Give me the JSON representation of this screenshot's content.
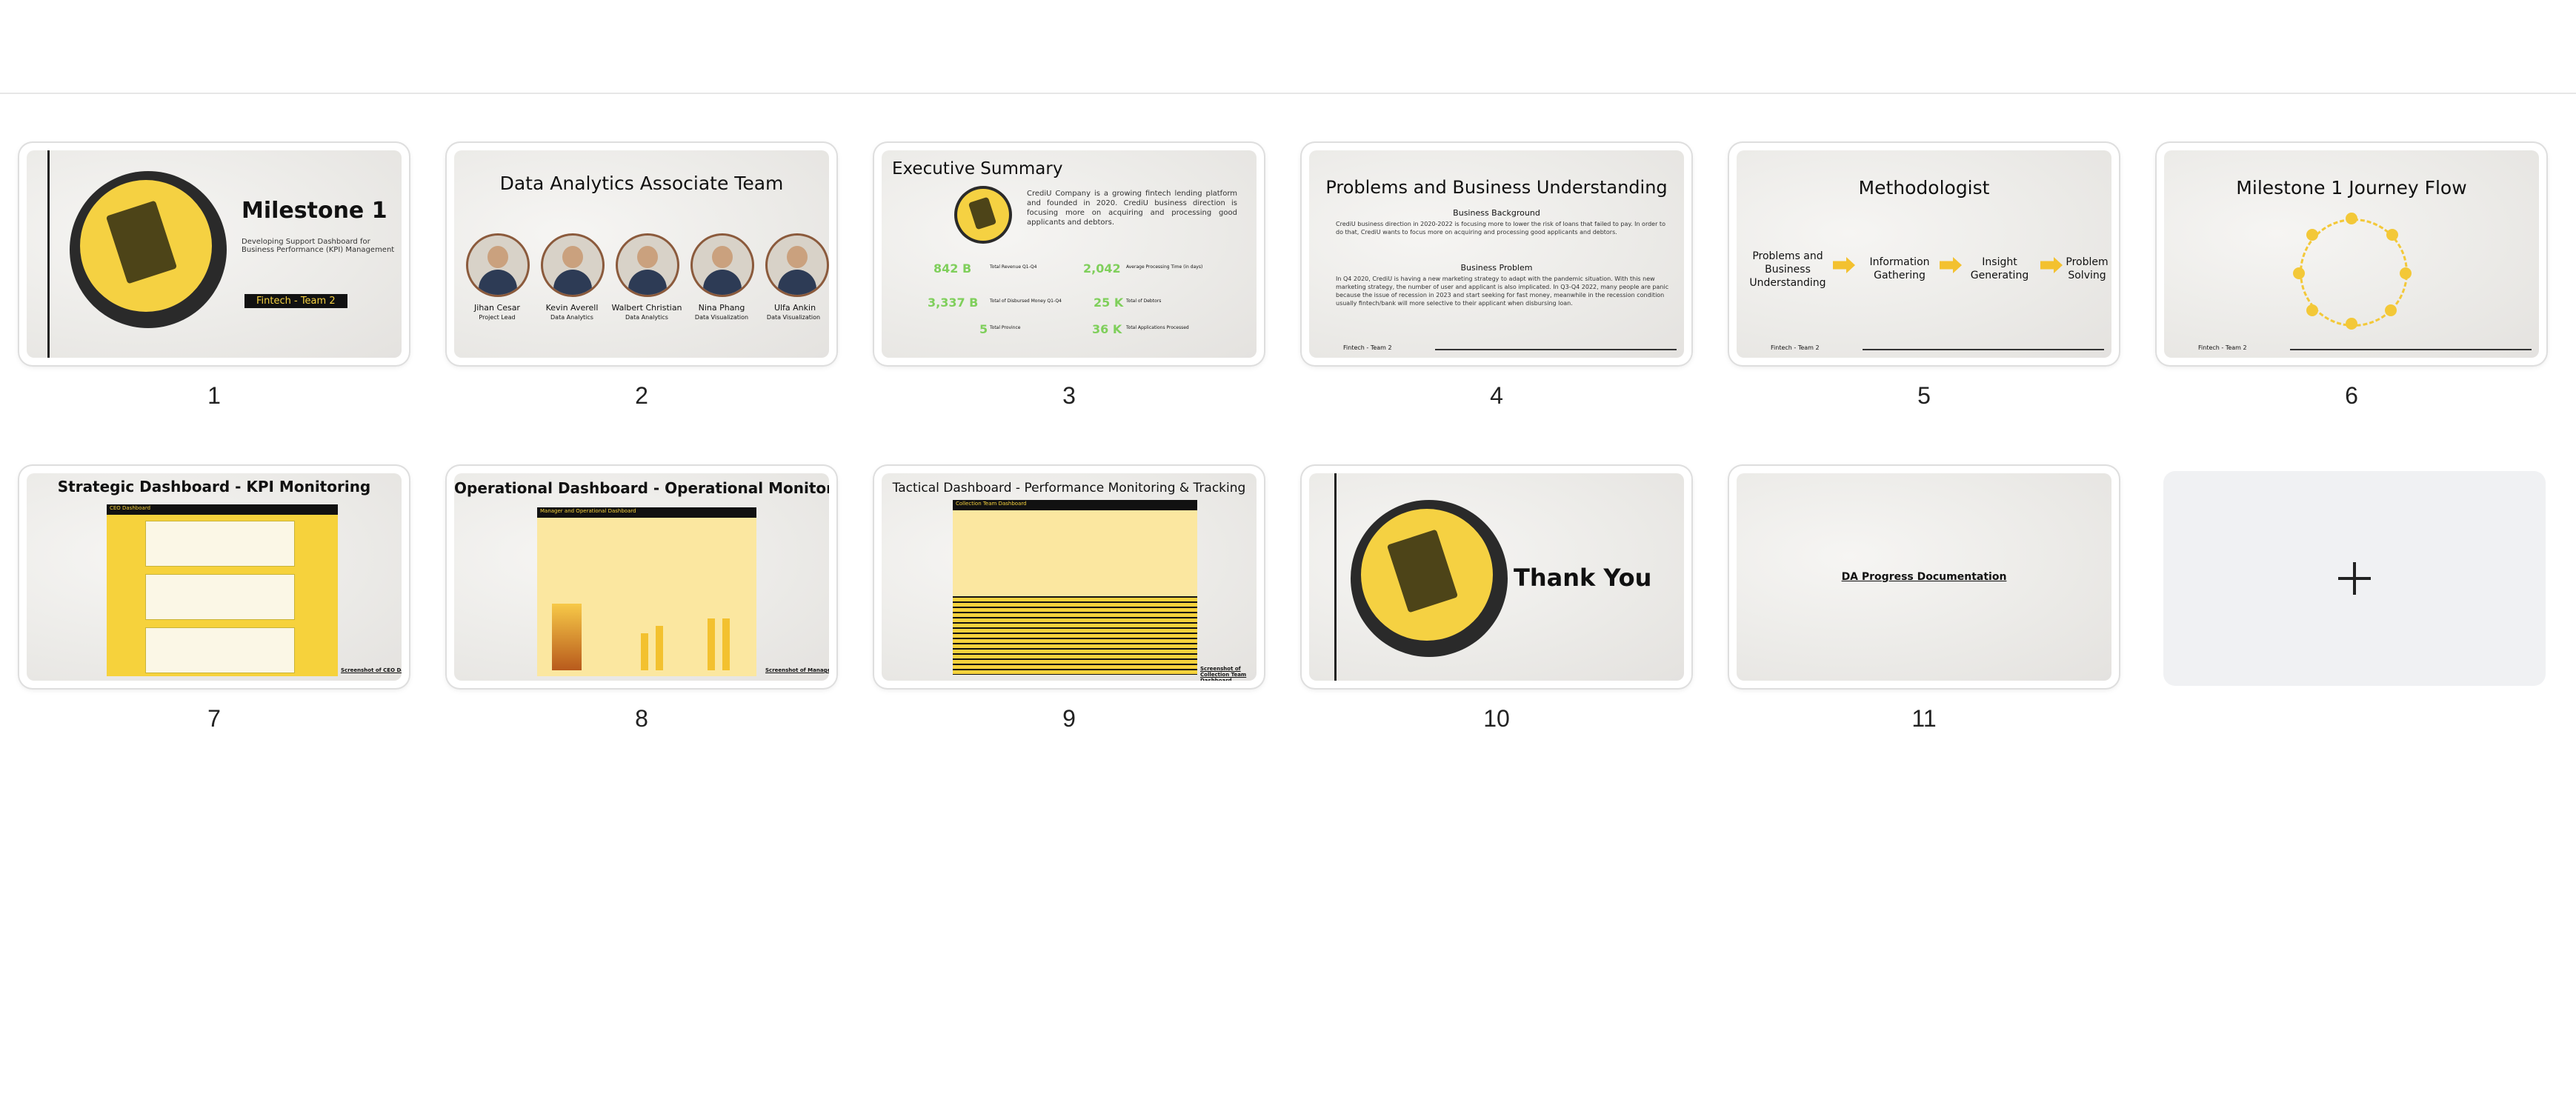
{
  "slides": [
    {
      "number": "1",
      "title": "Milestone 1",
      "subtitle": "Developing Support Dashboard for Business Performance (KPI) Management",
      "badge": "Fintech - Team 2"
    },
    {
      "number": "2",
      "title": "Data Analytics Associate Team",
      "members": [
        {
          "name": "Jihan Cesar",
          "role": "Project Lead"
        },
        {
          "name": "Kevin Averell",
          "role": "Data Analytics"
        },
        {
          "name": "Walbert Christian",
          "role": "Data Analytics"
        },
        {
          "name": "Nina Phang",
          "role": "Data Visualization"
        },
        {
          "name": "Ulfa Ankin",
          "role": "Data Visualization"
        }
      ]
    },
    {
      "number": "3",
      "title": "Executive Summary",
      "body": "CrediU Company is a growing fintech lending platform and founded in 2020. CrediU business direction is focusing more on acquiring and processing good applicants and debtors.",
      "kpis": [
        {
          "value": "842 B",
          "label": "Total Revenue Q1-Q4"
        },
        {
          "value": "2,042",
          "label": "Average Processing Time (in days)"
        },
        {
          "value": "3,337 B",
          "label": "Total of Disbursed Money Q1-Q4"
        },
        {
          "value": "25 K",
          "label": "Total of Debtors"
        },
        {
          "value": "5",
          "label": "Total Province"
        },
        {
          "value": "36 K",
          "label": "Total Applications Processed"
        }
      ]
    },
    {
      "number": "4",
      "title": "Problems and Business Understanding",
      "h1": "Business Background",
      "p1": "CrediU business direction in 2020-2022 is focusing more to lower the risk of loans that failed to pay. In order to do that, CrediU wants to focus more on acquiring and processing good applicants and debtors.",
      "h2": "Business Problem",
      "p2": "In Q4 2020, CrediU is having a new marketing strategy to adapt with the pandemic situation. With this new marketing strategy, the number of user and applicant is also implicated. In Q3-Q4 2022, many people are panic because the issue of recession in 2023 and start seeking for fast money, meanwhile in the recession condition usually fintech/bank will more selective to their applicant when disbursing loan.",
      "footer": "Fintech - Team 2"
    },
    {
      "number": "5",
      "title": "Methodologist",
      "steps": [
        "Problems and Business Understanding",
        "Information Gathering",
        "Insight Generating",
        "Problem Solving"
      ],
      "footer": "Fintech - Team 2"
    },
    {
      "number": "6",
      "title": "Milestone 1 Journey Flow",
      "footer": "Fintech - Team 2"
    },
    {
      "number": "7",
      "title": "Strategic Dashboard - KPI Monitoring",
      "dash_title": "CEO Dashboard",
      "link": "Screenshot of CEO Dashboard"
    },
    {
      "number": "8",
      "title": "Operational Dashboard - Operational Monitoring",
      "dash_title": "Manager and Operational Dashboard",
      "link": "Screenshot of Manager Dashboard"
    },
    {
      "number": "9",
      "title": "Tactical Dashboard - Performance Monitoring & Tracking",
      "dash_title": "Collection Team Dashboard",
      "link": "Screenshot of Collection Team Dashboard"
    },
    {
      "number": "10",
      "title": "Thank You"
    },
    {
      "number": "11",
      "title": "DA Progress Documentation"
    }
  ],
  "add_slide": {
    "label": "+"
  },
  "colors": {
    "accent": "#f5d142",
    "kpi": "#7fcf5b",
    "dark": "#111111"
  }
}
